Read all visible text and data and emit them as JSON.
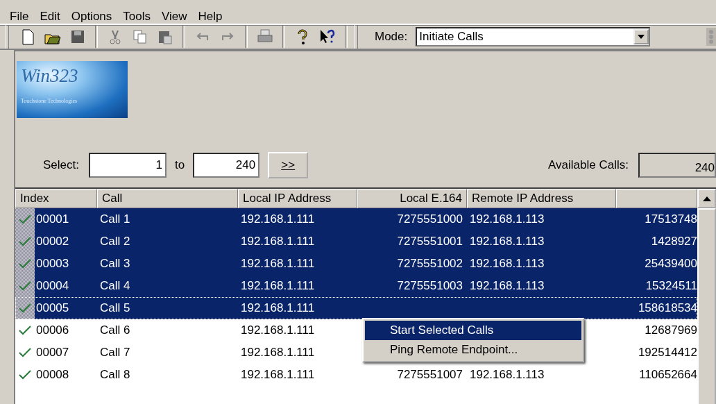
{
  "menu": [
    "File",
    "Edit",
    "Options",
    "Tools",
    "View",
    "Help"
  ],
  "toolbar": {
    "mode_label": "Mode:",
    "mode_value": "Initiate Calls"
  },
  "logo": {
    "title": "Win323",
    "subtitle": "Touchstone Technologies"
  },
  "select": {
    "label": "Select:",
    "from": "1",
    "to_label": "to",
    "to": "240",
    "go": ">>",
    "available_label": "Available Calls:",
    "available": "240"
  },
  "table": {
    "columns": [
      "Index",
      "Call",
      "Local IP Address",
      "Local E.164",
      "Remote IP Address"
    ],
    "rows": [
      {
        "index": "00001",
        "call": "Call 1",
        "local_ip": "192.168.1.111",
        "local_e164": "7275551000",
        "remote_ip": "192.168.1.113",
        "column_6": "17513748",
        "checked": true,
        "selected": true,
        "focused": false
      },
      {
        "index": "00002",
        "call": "Call 2",
        "local_ip": "192.168.1.111",
        "local_e164": "7275551001",
        "remote_ip": "192.168.1.113",
        "column_6": "1428927",
        "checked": true,
        "selected": true,
        "focused": false
      },
      {
        "index": "00003",
        "call": "Call 3",
        "local_ip": "192.168.1.111",
        "local_e164": "7275551002",
        "remote_ip": "192.168.1.113",
        "column_6": "25439400",
        "checked": true,
        "selected": true,
        "focused": false
      },
      {
        "index": "00004",
        "call": "Call 4",
        "local_ip": "192.168.1.111",
        "local_e164": "7275551003",
        "remote_ip": "192.168.1.113",
        "column_6": "15324511",
        "checked": true,
        "selected": true,
        "focused": false
      },
      {
        "index": "00005",
        "call": "Call 5",
        "local_ip": "192.168.1.111",
        "column_6": "158618534",
        "checked": true,
        "selected": true,
        "focused": true
      },
      {
        "index": "00006",
        "call": "Call 6",
        "local_ip": "192.168.1.111",
        "column_6": "12687969",
        "checked": true,
        "selected": false,
        "focused": false
      },
      {
        "index": "00007",
        "call": "Call 7",
        "local_ip": "192.168.1.111",
        "column_6": "192514412",
        "checked": true,
        "selected": false,
        "focused": false
      },
      {
        "index": "00008",
        "call": "Call 8",
        "local_ip": "192.168.1.111",
        "local_e164": "7275551007",
        "remote_ip": "192.168.1.113",
        "column_6": "110652664",
        "checked": true,
        "selected": false,
        "focused": false
      }
    ]
  },
  "context_menu": [
    {
      "label": "Start Selected Calls",
      "selected": true
    },
    {
      "label": "Ping Remote Endpoint...",
      "selected": false
    }
  ]
}
